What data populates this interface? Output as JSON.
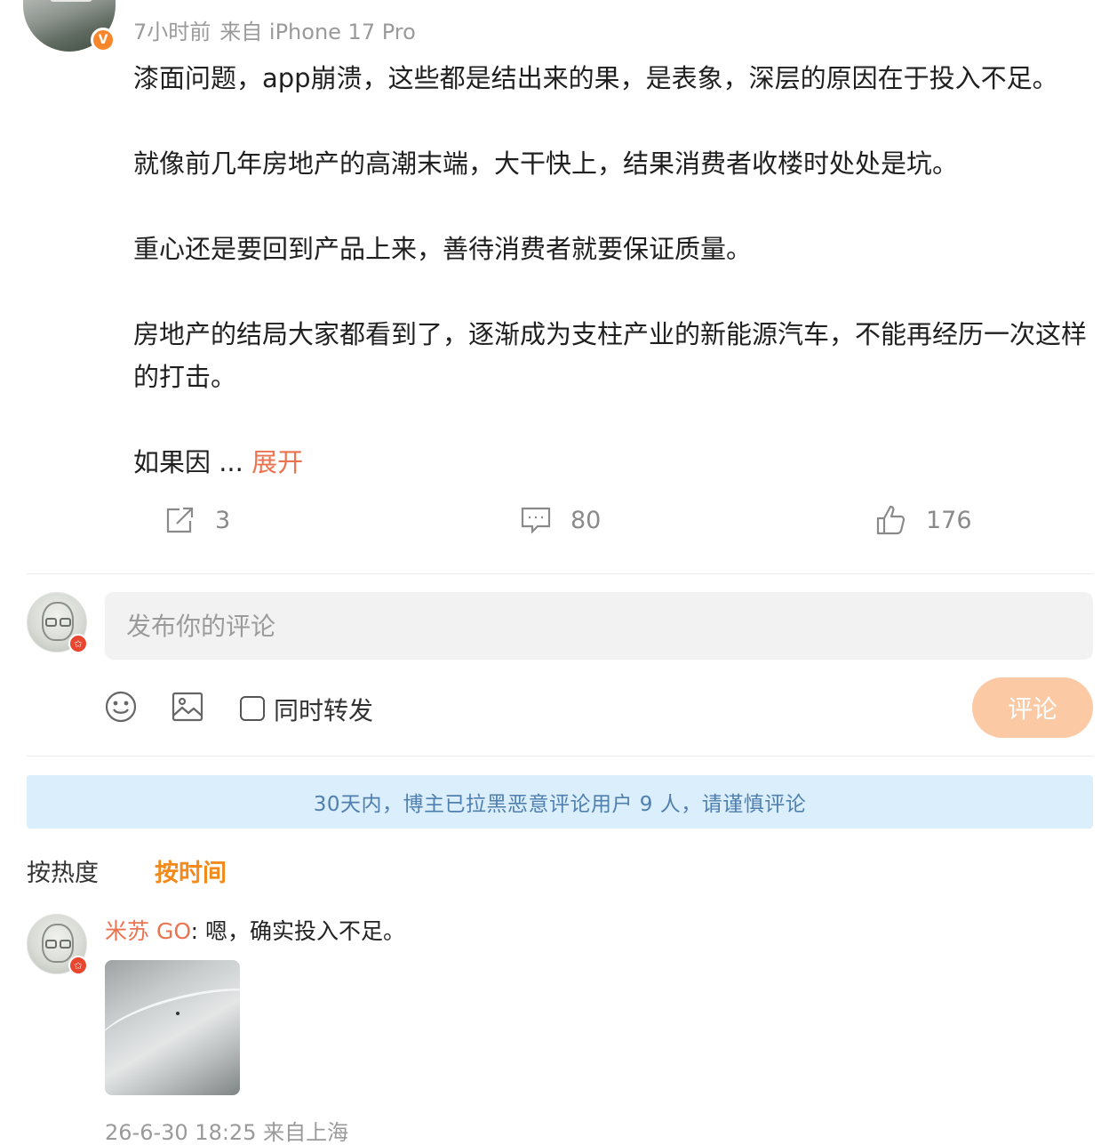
{
  "post": {
    "meta": {
      "time": "7小时前",
      "source": "来自 iPhone 17 Pro"
    },
    "paragraphs": [
      "漆面问题，app崩溃，这些都是结出来的果，是表象，深层的原因在于投入不足。",
      "就像前几年房地产的高潮末端，大干快上，结果消费者收楼时处处是坑。",
      "重心还是要回到产品上来，善待消费者就要保证质量。",
      "房地产的结局大家都看到了，逐渐成为支柱产业的新能源汽车，不能再经历一次这样的打击。"
    ],
    "truncated_text": "如果因 ...",
    "expand_label": "展开",
    "actions": {
      "repost_count": "3",
      "comment_count": "80",
      "like_count": "176"
    }
  },
  "composer": {
    "placeholder": "发布你的评论",
    "repost_label": "同时转发",
    "submit_label": "评论"
  },
  "notice": "30天内，博主已拉黑恶意评论用户 9 人，请谨慎评论",
  "sort": {
    "hot_label": "按热度",
    "time_label": "按时间"
  },
  "comments": [
    {
      "user": "米苏 GO",
      "separator": ":",
      "text": " 嗯，确实投入不足。",
      "timestamp": "26-6-30 18:25 来自上海"
    }
  ],
  "colors": {
    "accent_orange": "#eb7350",
    "sort_active": "#f28a1c",
    "submit_disabled": "#fbc9a4",
    "notice_bg": "#dbeefb",
    "notice_text": "#4e7fae"
  }
}
